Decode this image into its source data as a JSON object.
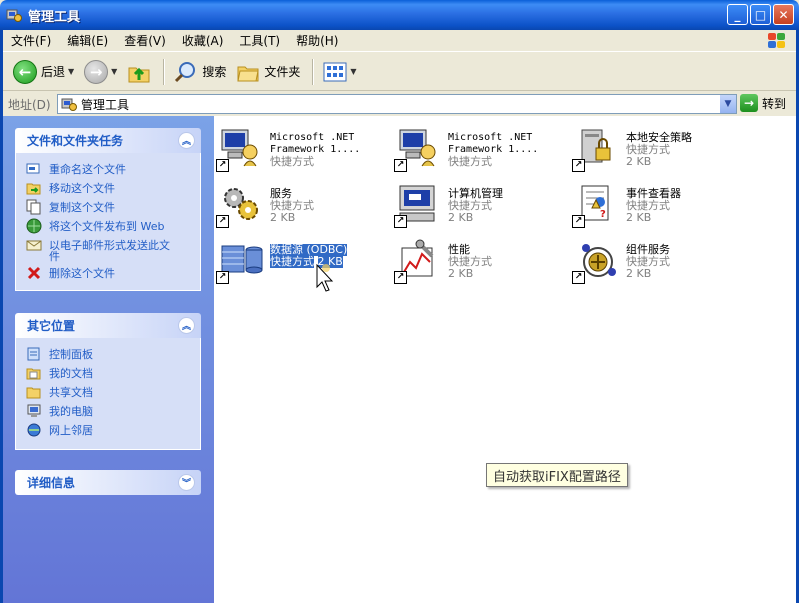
{
  "window": {
    "title": "管理工具"
  },
  "menu": [
    "文件(F)",
    "编辑(E)",
    "查看(V)",
    "收藏(A)",
    "工具(T)",
    "帮助(H)"
  ],
  "toolbar": {
    "back_label": "后退",
    "search_label": "搜索",
    "folders_label": "文件夹"
  },
  "address": {
    "label": "地址(D)",
    "value": "管理工具",
    "go_label": "转到"
  },
  "panels": {
    "tasks": {
      "title": "文件和文件夹任务",
      "items": [
        "重命名这个文件",
        "移动这个文件",
        "复制这个文件",
        "将这个文件发布到 Web",
        "以电子邮件形式发送此文件",
        "删除这个文件"
      ]
    },
    "places": {
      "title": "其它位置",
      "items": [
        "控制面板",
        "我的文档",
        "共享文档",
        "我的电脑",
        "网上邻居"
      ]
    },
    "details": {
      "title": "详细信息"
    }
  },
  "files": [
    {
      "name": "Microsoft .NET Framework 1....",
      "type": "快捷方式",
      "size": ""
    },
    {
      "name": "Microsoft .NET Framework 1....",
      "type": "快捷方式",
      "size": ""
    },
    {
      "name": "本地安全策略",
      "type": "快捷方式",
      "size": "2 KB"
    },
    {
      "name": "服务",
      "type": "快捷方式",
      "size": "2 KB"
    },
    {
      "name": "计算机管理",
      "type": "快捷方式",
      "size": "2 KB"
    },
    {
      "name": "事件查看器",
      "type": "快捷方式",
      "size": "2 KB"
    },
    {
      "name": "数据源 (ODBC)",
      "type": "快捷方式",
      "size": "2 KB"
    },
    {
      "name": "性能",
      "type": "快捷方式",
      "size": "2 KB"
    },
    {
      "name": "组件服务",
      "type": "快捷方式",
      "size": "2 KB"
    }
  ],
  "tooltip": "自动获取iFIX配置路径",
  "colors": {
    "accent": "#215dc6",
    "selection": "#316ac5",
    "titlebar": "#0a5fd8"
  }
}
